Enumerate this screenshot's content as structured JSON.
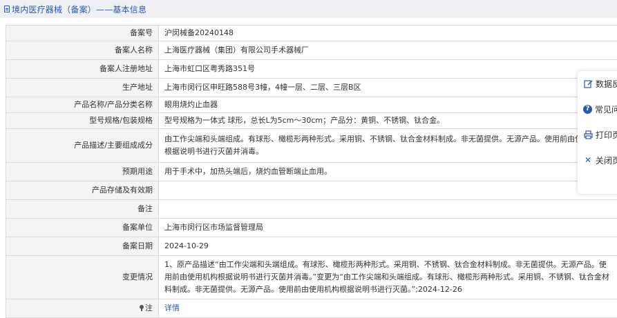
{
  "header": {
    "title": "境内医疗器械（备案）——基本信息",
    "icon": "document-icon"
  },
  "rows": [
    {
      "label": "备案号",
      "value": "沪闵械备20240148"
    },
    {
      "label": "备案人名称",
      "value": "上海医疗器械（集团）有限公司手术器械厂"
    },
    {
      "label": "备案人注册地址",
      "value": "上海市虹口区粤秀路351号"
    },
    {
      "label": "生产地址",
      "value": "上海市闵行区申旺路588号3幢，4幢一层、二层、三层B区"
    },
    {
      "label": "产品名称/产品分类名称",
      "value": "眼用烧灼止血器"
    },
    {
      "label": "型号规格/包装规格",
      "value": "型号规格为一体式 球形，总长L为5cm～30cm；产品分：黄铜、不锈钢、钛合金。"
    },
    {
      "label": "产品描述/主要组成成分",
      "value": "由工作尖端和头端组成。有球形、橄榄形两种形式。采用铜、不锈钢、钛合金材料制成。非无菌提供。无源产品。使用前由使用机构根据说明书进行灭菌并消毒。"
    },
    {
      "label": "预期用途",
      "value": "用于手术中，加热头端后，烧灼血管断端止血用。"
    },
    {
      "label": "产品存储及有效期",
      "value": ""
    },
    {
      "label": "备注",
      "value": ""
    },
    {
      "label": "备案单位",
      "value": "上海市闵行区市场监督管理局"
    },
    {
      "label": "备案日期",
      "value": "2024-10-29"
    },
    {
      "label": "变更情况",
      "value": "1、原产品描述“由工作尖端和头端组成。有球形、橄榄形两种形式。采用铜、不锈钢、钛合金材料制成。非无菌提供。无源产品。使用前由使用机构根据说明书进行灭菌并消毒。”变更为“由工作尖端和头端组成。有球形、橄榄形两种形式。采用铜、不锈钢、钛合金材料制成。非无菌提供。无源产品。使用前由使用机构根据说明书进行灭菌。”;2024-12-26"
    }
  ],
  "note": {
    "label": "注",
    "icon": "pin-icon",
    "link_text": "详情"
  },
  "float_menu": [
    {
      "label": "数据反",
      "icon": "edit-icon"
    },
    {
      "label": "常见问",
      "icon": "help-icon"
    },
    {
      "label": "打印页",
      "icon": "print-icon"
    },
    {
      "label": "关闭页",
      "icon": "close-icon"
    }
  ],
  "colors": {
    "accent": "#2a5ba8",
    "label_bg": "#f4f4f4",
    "border": "#d9d9d9",
    "header_bg": "#eef0f3"
  }
}
